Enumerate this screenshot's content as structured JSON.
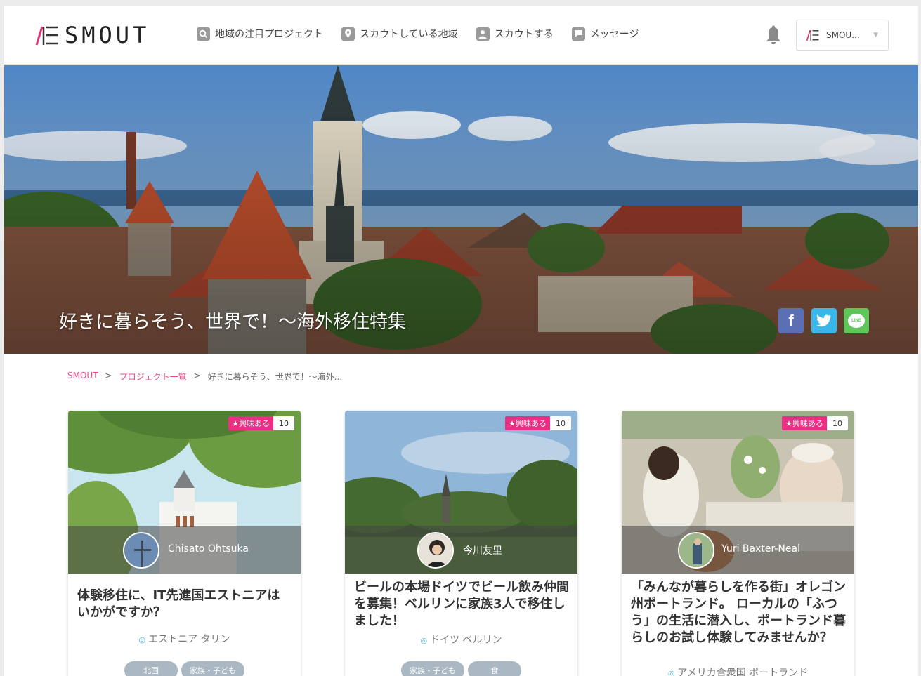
{
  "header": {
    "logo_text": "SMOUT",
    "nav": [
      {
        "label": "地域の注目プロジェクト",
        "icon": "search-icon"
      },
      {
        "label": "スカウトしている地域",
        "icon": "map-pin-icon"
      },
      {
        "label": "スカウトする",
        "icon": "person-icon"
      },
      {
        "label": "メッセージ",
        "icon": "chat-icon"
      }
    ],
    "account_name": "SMOU..."
  },
  "hero": {
    "title": "好きに暮らそう、世界で！〜海外移住特集",
    "share": [
      {
        "label": "f",
        "icon": "facebook-icon"
      },
      {
        "label": "t",
        "icon": "twitter-icon"
      },
      {
        "label": "LINE",
        "icon": "line-icon"
      }
    ]
  },
  "breadcrumb": {
    "items": [
      "SMOUT",
      "プロジェクト一覧",
      "好きに暮らそう、世界で！〜海外..."
    ],
    "separator": ">"
  },
  "cards": [
    {
      "badge_label": "★興味ある",
      "badge_count": "10",
      "author": "Chisato Ohtsuka",
      "title": "体験移住に、IT先進国エストニアはいかがですか？",
      "location": "エストニア タリン",
      "tags": [
        "北国",
        "家族・子ども"
      ]
    },
    {
      "badge_label": "★興味ある",
      "badge_count": "10",
      "author": "今川友里",
      "title": "ビールの本場ドイツでビール飲み仲間を募集！ベルリンに家族3人で移住しました！",
      "location": "ドイツ ベルリン",
      "tags": [
        "家族・子ども",
        "食"
      ]
    },
    {
      "badge_label": "★興味ある",
      "badge_count": "10",
      "author": "Yuri Baxter-Neal",
      "title": "「みんなが暮らしを作る街」オレゴン州ポートランド。 ローカルの「ふつう」の生活に潜入し、ポートランド暮らしのお試し体験してみませんか？",
      "location": "アメリカ合衆国 ポートランド",
      "tags": []
    }
  ],
  "colors": {
    "accent_pink": "#ec2f84",
    "link_pink": "#e8488a",
    "tag_gray": "#a9b8c3",
    "facebook": "#5a6fb4",
    "twitter": "#38b7e8",
    "line": "#5fc65a"
  }
}
